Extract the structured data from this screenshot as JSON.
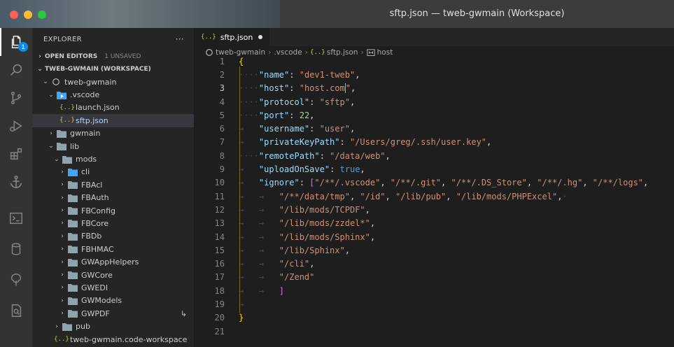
{
  "window": {
    "title": "sftp.json — tweb-gwmain (Workspace)"
  },
  "activity_bar": {
    "items": [
      {
        "name": "explorer-icon",
        "badge": "1"
      },
      {
        "name": "search-icon"
      },
      {
        "name": "source-control-icon"
      },
      {
        "name": "run-debug-icon"
      },
      {
        "name": "extensions-icon"
      },
      {
        "name": "anchor-icon"
      },
      {
        "name": "terminal-icon"
      },
      {
        "name": "database-icon"
      },
      {
        "name": "tree-icon"
      },
      {
        "name": "report-icon"
      }
    ]
  },
  "sidebar": {
    "title": "EXPLORER",
    "more": "···",
    "open_editors": {
      "label": "OPEN EDITORS",
      "unsaved": "1 UNSAVED"
    },
    "workspace": {
      "label": "TWEB-GWMAIN (WORKSPACE)"
    },
    "tree": [
      {
        "label": "tweb-gwmain",
        "indent": 1,
        "twisty": "⌄",
        "icon": "root"
      },
      {
        "label": ".vscode",
        "indent": 2,
        "twisty": "⌄",
        "icon": "folder-vscode"
      },
      {
        "label": "launch.json",
        "indent": 3,
        "twisty": "",
        "icon": "json"
      },
      {
        "label": "sftp.json",
        "indent": 3,
        "twisty": "",
        "icon": "json",
        "selected": true
      },
      {
        "label": "gwmain",
        "indent": 2,
        "twisty": "›",
        "icon": "folder"
      },
      {
        "label": "lib",
        "indent": 2,
        "twisty": "⌄",
        "icon": "folder"
      },
      {
        "label": "mods",
        "indent": 3,
        "twisty": "⌄",
        "icon": "folder"
      },
      {
        "label": "cli",
        "indent": 4,
        "twisty": "›",
        "icon": "folder-blue"
      },
      {
        "label": "FBAcl",
        "indent": 4,
        "twisty": "›",
        "icon": "folder"
      },
      {
        "label": "FBAuth",
        "indent": 4,
        "twisty": "›",
        "icon": "folder"
      },
      {
        "label": "FBConfig",
        "indent": 4,
        "twisty": "›",
        "icon": "folder"
      },
      {
        "label": "FBCore",
        "indent": 4,
        "twisty": "›",
        "icon": "folder"
      },
      {
        "label": "FBDb",
        "indent": 4,
        "twisty": "›",
        "icon": "folder"
      },
      {
        "label": "FBHMAC",
        "indent": 4,
        "twisty": "›",
        "icon": "folder"
      },
      {
        "label": "GWAppHelpers",
        "indent": 4,
        "twisty": "›",
        "icon": "folder"
      },
      {
        "label": "GWCore",
        "indent": 4,
        "twisty": "›",
        "icon": "folder"
      },
      {
        "label": "GWEDI",
        "indent": 4,
        "twisty": "›",
        "icon": "folder"
      },
      {
        "label": "GWModels",
        "indent": 4,
        "twisty": "›",
        "icon": "folder"
      },
      {
        "label": "GWPDF",
        "indent": 4,
        "twisty": "›",
        "icon": "folder",
        "trail": "↳"
      },
      {
        "label": "pub",
        "indent": 3,
        "twisty": "›",
        "icon": "folder"
      },
      {
        "label": "tweb-gwmain.code-workspace",
        "indent": 2,
        "twisty": "",
        "icon": "json"
      }
    ]
  },
  "editor": {
    "tab": {
      "icon": "{..}",
      "label": "sftp.json"
    },
    "breadcrumb": [
      {
        "label": "tweb-gwmain",
        "icon": "root"
      },
      {
        "label": ".vscode"
      },
      {
        "label": "sftp.json",
        "icon": "json"
      },
      {
        "label": "host",
        "icon": "field"
      }
    ],
    "current_line": 3,
    "lines": [
      [
        [
          "br",
          "{"
        ]
      ],
      [
        [
          "ws",
          "····"
        ],
        [
          "k",
          "\"name\""
        ],
        [
          "p",
          ": "
        ],
        [
          "s",
          "\"dev1-tweb\""
        ],
        [
          "p",
          ","
        ]
      ],
      [
        [
          "ws",
          "····"
        ],
        [
          "k",
          "\"host\""
        ],
        [
          "p",
          ": "
        ],
        [
          "s",
          "\"host.com"
        ],
        [
          "cur",
          ""
        ],
        [
          "s",
          "\""
        ],
        [
          "p",
          ","
        ]
      ],
      [
        [
          "ws",
          "····"
        ],
        [
          "k",
          "\"protocol\""
        ],
        [
          "p",
          ": "
        ],
        [
          "s",
          "\"sftp\""
        ],
        [
          "p",
          ","
        ]
      ],
      [
        [
          "ws",
          "····"
        ],
        [
          "k",
          "\"port\""
        ],
        [
          "p",
          ": "
        ],
        [
          "n",
          "22"
        ],
        [
          "p",
          ","
        ]
      ],
      [
        [
          "ws",
          "→   "
        ],
        [
          "k",
          "\"username\""
        ],
        [
          "p",
          ": "
        ],
        [
          "s",
          "\"user\""
        ],
        [
          "p",
          ","
        ]
      ],
      [
        [
          "ws",
          "→   "
        ],
        [
          "k",
          "\"privateKeyPath\""
        ],
        [
          "p",
          ": "
        ],
        [
          "s",
          "\"/Users/greg/.ssh/user.key\""
        ],
        [
          "p",
          ","
        ]
      ],
      [
        [
          "ws",
          "····"
        ],
        [
          "k",
          "\"remotePath\""
        ],
        [
          "p",
          ": "
        ],
        [
          "s",
          "\"/data/web\""
        ],
        [
          "p",
          ","
        ]
      ],
      [
        [
          "ws",
          "→   "
        ],
        [
          "k",
          "\"uploadOnSave\""
        ],
        [
          "p",
          ": "
        ],
        [
          "b",
          "true"
        ],
        [
          "p",
          ","
        ]
      ],
      [
        [
          "ws",
          "→   "
        ],
        [
          "k",
          "\"ignore\""
        ],
        [
          "p",
          ": "
        ],
        [
          "br2",
          "["
        ],
        [
          "s",
          "\"/**/.vscode\""
        ],
        [
          "p",
          ", "
        ],
        [
          "s",
          "\"/**/.git\""
        ],
        [
          "p",
          ", "
        ],
        [
          "s",
          "\"/**/.DS_Store\""
        ],
        [
          "p",
          ", "
        ],
        [
          "s",
          "\"/**/.hg\""
        ],
        [
          "p",
          ", "
        ],
        [
          "s",
          "\"/**/logs\""
        ],
        [
          "p",
          ","
        ]
      ],
      [
        [
          "ws",
          "→   →   "
        ],
        [
          "s",
          "\"/**/data/tmp\""
        ],
        [
          "p",
          ", "
        ],
        [
          "s",
          "\"/id\""
        ],
        [
          "p",
          ", "
        ],
        [
          "s",
          "\"/lib/pub\""
        ],
        [
          "p",
          ", "
        ],
        [
          "s",
          "\"/lib/mods/PHPExcel\""
        ],
        [
          "p",
          ","
        ],
        [
          "ws",
          "·"
        ]
      ],
      [
        [
          "ws",
          "→   →   "
        ],
        [
          "s",
          "\"/lib/mods/TCPDF\""
        ],
        [
          "p",
          ","
        ]
      ],
      [
        [
          "ws",
          "→   →   "
        ],
        [
          "s",
          "\"/lib/mods/zzdel*\""
        ],
        [
          "p",
          ","
        ]
      ],
      [
        [
          "ws",
          "→   →   "
        ],
        [
          "s",
          "\"/lib/mods/Sphinx\""
        ],
        [
          "p",
          ","
        ]
      ],
      [
        [
          "ws",
          "→   →   "
        ],
        [
          "s",
          "\"/lib/Sphinx\""
        ],
        [
          "p",
          ","
        ]
      ],
      [
        [
          "ws",
          "→   →   "
        ],
        [
          "s",
          "\"/cli\""
        ],
        [
          "p",
          ","
        ]
      ],
      [
        [
          "ws",
          "→   →   "
        ],
        [
          "s",
          "\"/Zend\""
        ]
      ],
      [
        [
          "ws",
          "→   →   "
        ],
        [
          "br2",
          "]"
        ]
      ],
      [
        [
          "ws",
          "→"
        ]
      ],
      [
        [
          "br",
          "}"
        ]
      ],
      []
    ]
  },
  "colors": {
    "accent": "#0e8ae6",
    "json_icon": "#cbcb41",
    "folder": "#90a4ae",
    "folder_blue": "#42a5f5"
  }
}
